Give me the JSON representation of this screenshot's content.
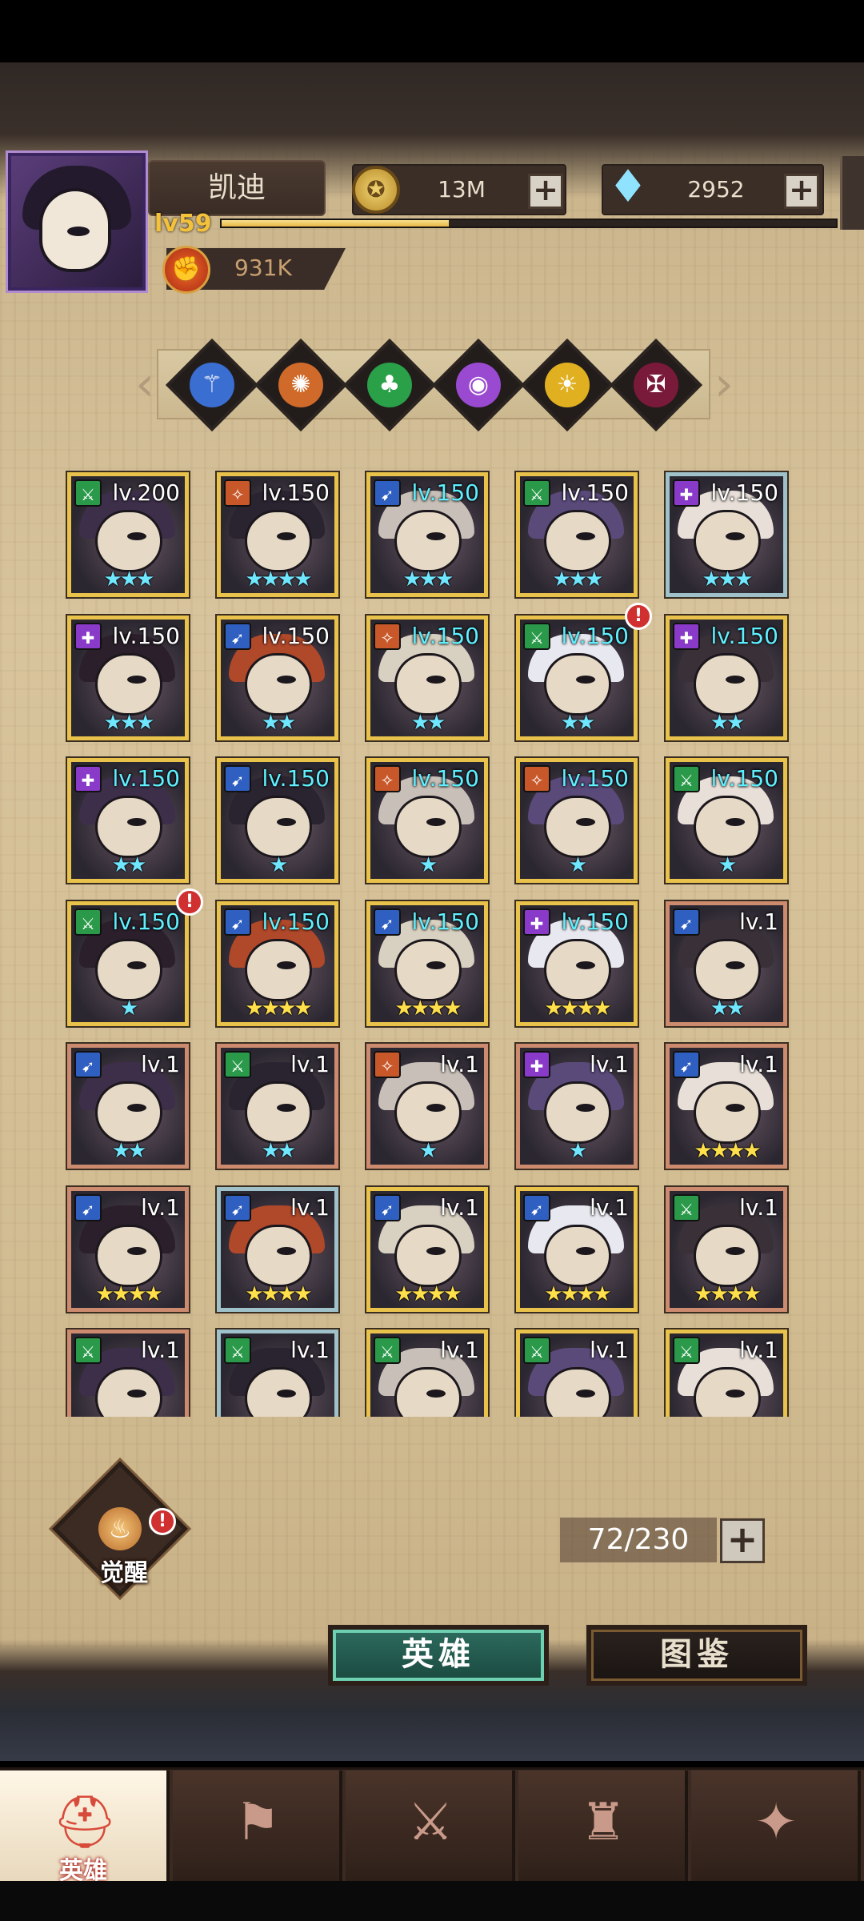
{
  "player": {
    "name": "凯迪",
    "level_label": "lv59",
    "xp_fraction": 0.37,
    "power": "931K"
  },
  "resources": {
    "gold": "13M",
    "gems": "2952",
    "plus_symbol": "+"
  },
  "factions": [
    "faction-blue-icon",
    "faction-orange-icon",
    "faction-green-icon",
    "faction-purple-icon",
    "faction-yellow-icon",
    "faction-dark-icon"
  ],
  "heroes": [
    {
      "level": "lv.200",
      "stars": "★★★",
      "star_color": "cyan",
      "class": "green",
      "frame": "gold",
      "lv_color": "white",
      "badge": false
    },
    {
      "level": "lv.150",
      "stars": "★★★★",
      "star_color": "cyan",
      "class": "orange",
      "frame": "gold",
      "lv_color": "white",
      "badge": false
    },
    {
      "level": "lv.150",
      "stars": "★★★",
      "star_color": "cyan",
      "class": "blue",
      "frame": "gold",
      "lv_color": "cyan",
      "badge": false
    },
    {
      "level": "lv.150",
      "stars": "★★★",
      "star_color": "cyan",
      "class": "green",
      "frame": "gold",
      "lv_color": "white",
      "badge": false
    },
    {
      "level": "lv.150",
      "stars": "★★★",
      "star_color": "cyan",
      "class": "purple",
      "frame": "silver",
      "lv_color": "white",
      "badge": false
    },
    {
      "level": "lv.150",
      "stars": "★★★",
      "star_color": "cyan",
      "class": "purple",
      "frame": "gold",
      "lv_color": "white",
      "badge": false
    },
    {
      "level": "lv.150",
      "stars": "★★",
      "star_color": "cyan",
      "class": "blue",
      "frame": "gold",
      "lv_color": "white",
      "badge": false
    },
    {
      "level": "lv.150",
      "stars": "★★",
      "star_color": "cyan",
      "class": "orange",
      "frame": "gold",
      "lv_color": "cyan",
      "badge": false
    },
    {
      "level": "lv.150",
      "stars": "★★",
      "star_color": "cyan",
      "class": "green",
      "frame": "gold",
      "lv_color": "cyan",
      "badge": true
    },
    {
      "level": "lv.150",
      "stars": "★★",
      "star_color": "cyan",
      "class": "purple",
      "frame": "gold",
      "lv_color": "cyan",
      "badge": false
    },
    {
      "level": "lv.150",
      "stars": "★★",
      "star_color": "cyan",
      "class": "purple",
      "frame": "gold",
      "lv_color": "cyan",
      "badge": false
    },
    {
      "level": "lv.150",
      "stars": "★",
      "star_color": "cyan",
      "class": "blue",
      "frame": "gold",
      "lv_color": "cyan",
      "badge": false
    },
    {
      "level": "lv.150",
      "stars": "★",
      "star_color": "cyan",
      "class": "orange",
      "frame": "gold",
      "lv_color": "cyan",
      "badge": false
    },
    {
      "level": "lv.150",
      "stars": "★",
      "star_color": "cyan",
      "class": "orange",
      "frame": "gold",
      "lv_color": "cyan",
      "badge": false
    },
    {
      "level": "lv.150",
      "stars": "★",
      "star_color": "cyan",
      "class": "green",
      "frame": "gold",
      "lv_color": "cyan",
      "badge": false
    },
    {
      "level": "lv.150",
      "stars": "★",
      "star_color": "cyan",
      "class": "green",
      "frame": "gold",
      "lv_color": "cyan",
      "badge": true
    },
    {
      "level": "lv.150",
      "stars": "★★★★",
      "star_color": "gold",
      "class": "blue",
      "frame": "gold",
      "lv_color": "cyan",
      "badge": false
    },
    {
      "level": "lv.150",
      "stars": "★★★★",
      "star_color": "gold",
      "class": "blue",
      "frame": "gold",
      "lv_color": "cyan",
      "badge": false
    },
    {
      "level": "lv.150",
      "stars": "★★★★",
      "star_color": "gold",
      "class": "purple",
      "frame": "gold",
      "lv_color": "cyan",
      "badge": false
    },
    {
      "level": "lv.1",
      "stars": "★★",
      "star_color": "cyan",
      "class": "blue",
      "frame": "bronze",
      "lv_color": "white",
      "badge": false
    },
    {
      "level": "lv.1",
      "stars": "★★",
      "star_color": "cyan",
      "class": "blue",
      "frame": "bronze",
      "lv_color": "white",
      "badge": false
    },
    {
      "level": "lv.1",
      "stars": "★★",
      "star_color": "cyan",
      "class": "green",
      "frame": "bronze",
      "lv_color": "white",
      "badge": false
    },
    {
      "level": "lv.1",
      "stars": "★",
      "star_color": "cyan",
      "class": "orange",
      "frame": "bronze",
      "lv_color": "white",
      "badge": false
    },
    {
      "level": "lv.1",
      "stars": "★",
      "star_color": "cyan",
      "class": "purple",
      "frame": "bronze",
      "lv_color": "white",
      "badge": false
    },
    {
      "level": "lv.1",
      "stars": "★★★★",
      "star_color": "gold",
      "class": "blue",
      "frame": "bronze",
      "lv_color": "white",
      "badge": false
    },
    {
      "level": "lv.1",
      "stars": "★★★★",
      "star_color": "gold",
      "class": "blue",
      "frame": "bronze",
      "lv_color": "white",
      "badge": false
    },
    {
      "level": "lv.1",
      "stars": "★★★★",
      "star_color": "gold",
      "class": "blue",
      "frame": "silver",
      "lv_color": "white",
      "badge": false
    },
    {
      "level": "lv.1",
      "stars": "★★★★",
      "star_color": "gold",
      "class": "blue",
      "frame": "gold",
      "lv_color": "white",
      "badge": false
    },
    {
      "level": "lv.1",
      "stars": "★★★★",
      "star_color": "gold",
      "class": "blue",
      "frame": "gold",
      "lv_color": "white",
      "badge": false
    },
    {
      "level": "lv.1",
      "stars": "★★★★",
      "star_color": "gold",
      "class": "green",
      "frame": "bronze",
      "lv_color": "white",
      "badge": false
    },
    {
      "level": "lv.1",
      "stars": "",
      "star_color": "gold",
      "class": "green",
      "frame": "bronze",
      "lv_color": "white",
      "badge": false
    },
    {
      "level": "lv.1",
      "stars": "",
      "star_color": "gold",
      "class": "green",
      "frame": "silver",
      "lv_color": "white",
      "badge": false
    },
    {
      "level": "lv.1",
      "stars": "",
      "star_color": "gold",
      "class": "green",
      "frame": "gold",
      "lv_color": "white",
      "badge": false
    },
    {
      "level": "lv.1",
      "stars": "",
      "star_color": "gold",
      "class": "green",
      "frame": "gold",
      "lv_color": "white",
      "badge": false
    },
    {
      "level": "lv.1",
      "stars": "",
      "star_color": "gold",
      "class": "green",
      "frame": "gold",
      "lv_color": "white",
      "badge": false
    }
  ],
  "awaken": {
    "label": "觉醒",
    "alert": "!"
  },
  "hero_count": "72/230",
  "subtabs": {
    "heroes": "英雄",
    "codex": "图鉴"
  },
  "nav": [
    {
      "label": "英雄",
      "icon": "helmet-icon",
      "active": true
    },
    {
      "label": "",
      "icon": "guild-flag-icon",
      "active": false
    },
    {
      "label": "",
      "icon": "battle-icon",
      "active": false
    },
    {
      "label": "",
      "icon": "castle-icon",
      "active": false
    },
    {
      "label": "",
      "icon": "alliance-icon",
      "active": false
    }
  ],
  "colors": {
    "gold_frame": "#e8c24a",
    "bronze_frame": "#cc8a6e",
    "silver_frame": "#9fc1c9",
    "cyan_text": "#5ff0ff",
    "active_tab": "#2d6b5e"
  }
}
